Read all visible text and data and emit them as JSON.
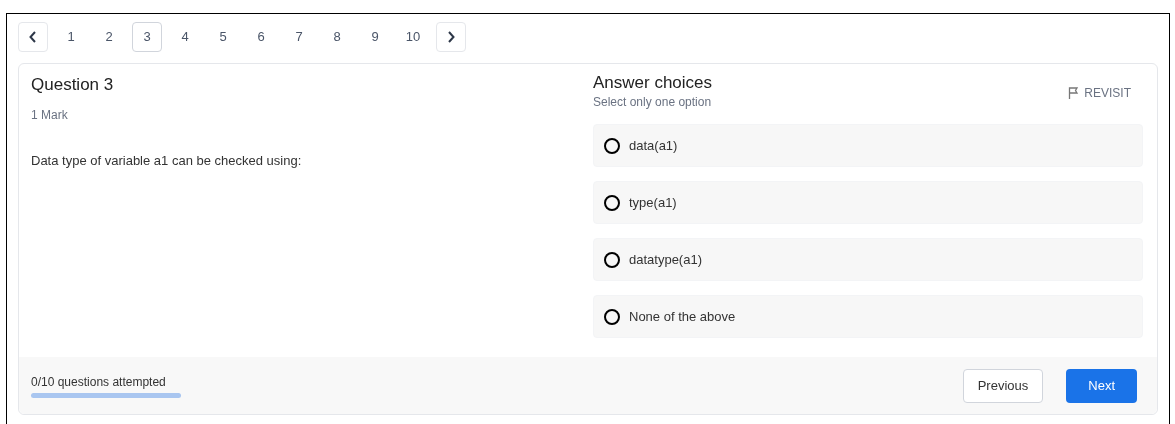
{
  "pagination": {
    "pages": [
      {
        "label": "1",
        "selected": false
      },
      {
        "label": "2",
        "selected": false
      },
      {
        "label": "3",
        "selected": true
      },
      {
        "label": "4",
        "selected": false
      },
      {
        "label": "5",
        "selected": false
      },
      {
        "label": "6",
        "selected": false
      },
      {
        "label": "7",
        "selected": false
      },
      {
        "label": "8",
        "selected": false
      },
      {
        "label": "9",
        "selected": false
      },
      {
        "label": "10",
        "selected": false
      }
    ]
  },
  "question": {
    "title": "Question 3",
    "marks": "1 Mark",
    "text": "Data type of variable a1 can be checked using:"
  },
  "answers": {
    "title": "Answer choices",
    "hint": "Select only one option",
    "revisit": "REVISIT",
    "options": [
      {
        "label": "data(a1)",
        "selected": false
      },
      {
        "label": "type(a1)",
        "selected": false
      },
      {
        "label": "datatype(a1)",
        "selected": false
      },
      {
        "label": "None of the above",
        "selected": false
      }
    ]
  },
  "footer": {
    "progress_text": "0/10 questions attempted",
    "level": 0,
    "previous": "Previous",
    "next": "Next"
  }
}
